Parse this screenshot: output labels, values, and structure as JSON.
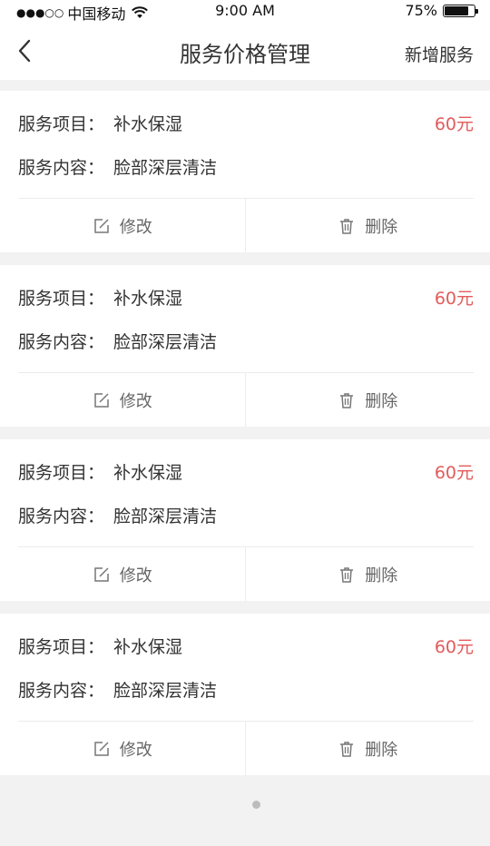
{
  "status_bar": {
    "carrier": "中国移动",
    "signal": "●●●○○",
    "time": "9:00 AM",
    "battery": "75%"
  },
  "nav": {
    "title": "服务价格管理",
    "add_label": "新增服务"
  },
  "services": [
    {
      "item_label": "服务项目：",
      "item": "补水保湿",
      "content_label": "服务内容：",
      "content": "脸部深层清洁",
      "price": "60元",
      "edit": "修改",
      "delete": "删除"
    },
    {
      "item_label": "服务项目：",
      "item": "补水保湿",
      "content_label": "服务内容：",
      "content": "脸部深层清洁",
      "price": "60元",
      "edit": "修改",
      "delete": "删除"
    },
    {
      "item_label": "服务项目：",
      "item": "补水保湿",
      "content_label": "服务内容：",
      "content": "脸部深层清洁",
      "price": "60元",
      "edit": "修改",
      "delete": "删除"
    },
    {
      "item_label": "服务项目：",
      "item": "补水保湿",
      "content_label": "服务内容：",
      "content": "脸部深层清洁",
      "price": "60元",
      "edit": "修改",
      "delete": "删除"
    }
  ],
  "colors": {
    "price": "#e25b5b",
    "background": "#f2f2f2",
    "text": "#333333"
  },
  "icons": {
    "back": "chevron-left-icon",
    "edit": "edit-icon",
    "delete": "trash-icon",
    "wifi": "wifi-icon"
  }
}
